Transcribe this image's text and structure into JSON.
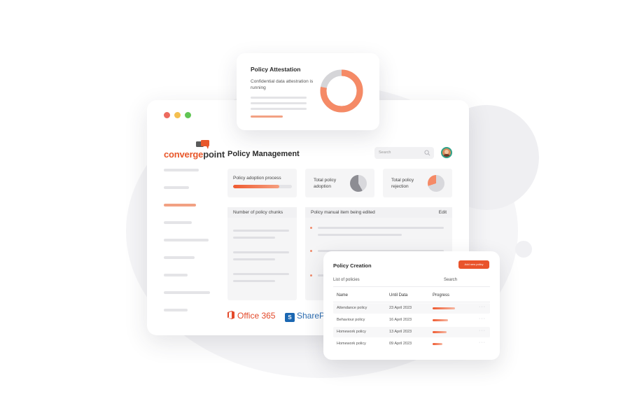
{
  "colors": {
    "accent": "#e9532b",
    "mac_red": "#ed6a5e",
    "mac_yellow": "#f4bf4f",
    "mac_green": "#61c554",
    "pie_gray": "#8d8d93",
    "pie_orange": "#f58a66"
  },
  "app": {
    "brand_part1": "converge",
    "brand_part2": "point",
    "page_title": "Policy Management"
  },
  "header": {
    "search_placeholder": "Search",
    "search_icon": "search-icon",
    "avatar_icon": "user-avatar"
  },
  "stats": {
    "adoption_process": {
      "label": "Policy adoption process",
      "progress": 0.78
    },
    "total_adoption": {
      "label_line1": "Total policy",
      "label_line2": "adoption",
      "fraction": 0.58
    },
    "total_rejection": {
      "label_line1": "Total policy",
      "label_line2": "rejection",
      "fraction": 0.3
    }
  },
  "panels": {
    "chunks": {
      "title": "Number of policy chunks"
    },
    "manual": {
      "title": "Policy manual item being edited",
      "edit_label": "Edit"
    }
  },
  "integrations": {
    "office": "Office 365",
    "sharepoint": "ShareP",
    "sharepoint_icon_letter": "S"
  },
  "attestation": {
    "title": "Policy Attestation",
    "subtitle": "Confidential data attestration is running",
    "donut_fraction": 0.78
  },
  "creation": {
    "title": "Policy Creation",
    "add_button": "Add new policy",
    "list_label": "List of policies",
    "search_label": "Search",
    "columns": [
      "Name",
      "Until Data",
      "Progress"
    ],
    "rows": [
      {
        "name": "Attendance policy",
        "date": "23 April 2023",
        "progress": 0.8
      },
      {
        "name": "Behaviour policy",
        "date": "16 April 2023",
        "progress": 0.55
      },
      {
        "name": "Homework policy",
        "date": "13 April 2023",
        "progress": 0.5
      },
      {
        "name": "Homework policy",
        "date": "09 April 2023",
        "progress": 0.35
      }
    ]
  }
}
